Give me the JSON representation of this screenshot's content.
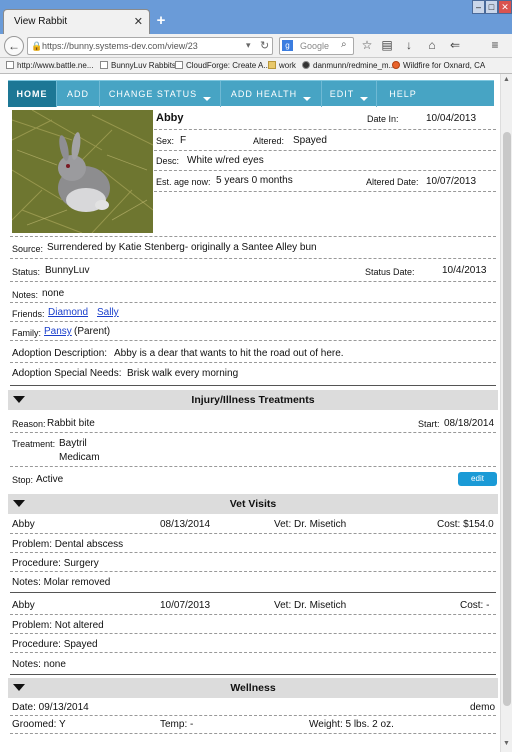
{
  "browser": {
    "tab_title": "View Rabbit",
    "url": "https://bunny.systems-dev.com/view/23",
    "search_placeholder": "Google",
    "bookmarks": [
      "http://www.battle.ne...",
      "BunnyLuv Rabbits",
      "CloudForge: Create A...",
      "work",
      "danmunn/redmine_m...",
      "Wildfire for Oxnard, CA"
    ]
  },
  "menu": [
    {
      "label": "HOME",
      "dropdown": false
    },
    {
      "label": "ADD",
      "dropdown": false
    },
    {
      "label": "CHANGE STATUS",
      "dropdown": true
    },
    {
      "label": "ADD HEALTH",
      "dropdown": true
    },
    {
      "label": "EDIT",
      "dropdown": true
    },
    {
      "label": "HELP",
      "dropdown": false
    }
  ],
  "rabbit": {
    "name": "Abby",
    "date_in_label": "Date In:",
    "date_in": "10/04/2013",
    "sex_label": "Sex:",
    "sex": "F",
    "altered_label": "Altered:",
    "altered": "Spayed",
    "desc_label": "Desc:",
    "desc": "White w/red eyes",
    "age_label": "Est. age now:",
    "age": "5 years 0 months",
    "altered_date_label": "Altered Date:",
    "altered_date": "10/07/2013",
    "source_label": "Source:",
    "source": "Surrendered by Katie Stenberg- originally a Santee Alley bun",
    "status_label": "Status:",
    "status": "BunnyLuv",
    "status_date_label": "Status Date:",
    "status_date": "10/4/2013",
    "notes_label": "Notes:",
    "notes": "none",
    "friends_label": "Friends:",
    "friends": [
      "Diamond",
      "Sally"
    ],
    "family_label": "Family:",
    "family_name": "Pansy",
    "family_rel": "(Parent)",
    "adoption_desc_label": "Adoption Description:",
    "adoption_desc": "Abby is a dear that wants to hit the road out of here.",
    "adoption_needs_label": "Adoption Special Needs:",
    "adoption_needs": "Brisk walk every morning"
  },
  "injury": {
    "title": "Injury/Illness Treatments",
    "reason_label": "Reason:",
    "reason": "Rabbit bite",
    "start_label": "Start:",
    "start": "08/18/2014",
    "treatment_label": "Treatment:",
    "treatments": [
      "Baytril",
      "Medicam"
    ],
    "stop_label": "Stop:",
    "stop": "Active",
    "edit_label": "edit"
  },
  "vet": {
    "title": "Vet Visits",
    "visits": [
      {
        "name": "Abby",
        "date": "08/13/2014",
        "vet": "Vet: Dr. Misetich",
        "cost": "Cost: $154.0",
        "problem": "Problem: Dental abscess",
        "procedure": "Procedure: Surgery",
        "notes": "Notes: Molar removed"
      },
      {
        "name": "Abby",
        "date": "10/07/2013",
        "vet": "Vet: Dr. Misetich",
        "cost": "Cost:  -",
        "problem": "Problem: Not altered",
        "procedure": "Procedure: Spayed",
        "notes": "Notes: none"
      }
    ]
  },
  "wellness": {
    "title": "Wellness",
    "date": "Date: 09/13/2014",
    "user": "demo",
    "groomed": "Groomed: Y",
    "temp": "Temp: -",
    "weight": "Weight: 5 lbs. 2 oz."
  }
}
